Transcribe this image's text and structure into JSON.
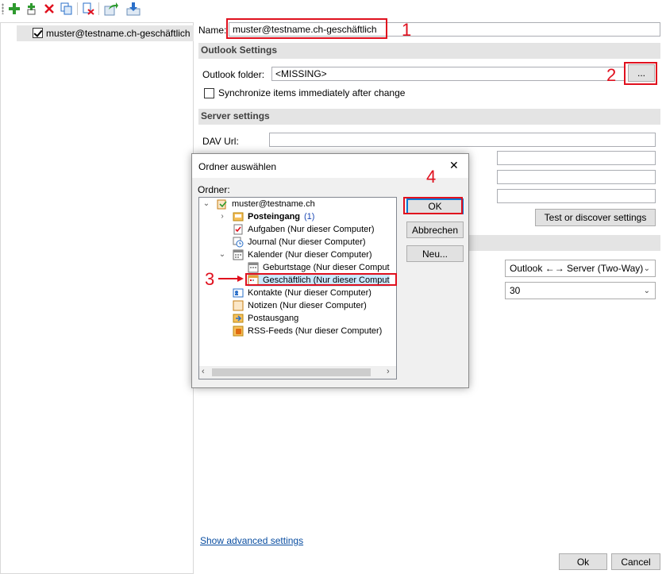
{
  "toolbar": {
    "items": [
      {
        "name": "add-profile-icon",
        "color": "#2e9a2e"
      },
      {
        "name": "add-multiple-profiles-icon",
        "color": "#2e9a2e"
      },
      {
        "name": "delete-icon",
        "color": "#e0101e"
      },
      {
        "name": "copy-icon",
        "color": "#2a6fc9"
      },
      {
        "name": "clear-cache-icon",
        "color": "#e0101e"
      },
      {
        "name": "export-icon",
        "color": "#2e9a2e"
      },
      {
        "name": "import-icon",
        "color": "#2a6fc9"
      }
    ]
  },
  "tree": {
    "profile_label": "muster@testname.ch-geschäftlich",
    "profile_checked": true
  },
  "form": {
    "name_label": "Name:",
    "name_value": "muster@testname.ch-geschäftlich",
    "outlook_section": "Outlook Settings",
    "outlook_folder_label": "Outlook folder:",
    "outlook_folder_value": "<MISSING>",
    "browse_label": "...",
    "sync_label": "Synchronize items immediately after change",
    "server_section": "Server settings",
    "dav_url_label": "DAV Url:",
    "test_button": "Test or discover settings",
    "sync_mode_value": "Outlook ←→ Server (Two-Way)",
    "sync_interval_value": "30",
    "advanced_link": "Show advanced settings",
    "ok_button": "Ok",
    "cancel_button": "Cancel"
  },
  "annotations": {
    "n1": "1",
    "n2": "2",
    "n3": "3",
    "n4": "4",
    "color": "#e0101e"
  },
  "dialog": {
    "title": "Ordner auswählen",
    "close": "✕",
    "folder_label": "Ordner:",
    "ok": "OK",
    "cancel": "Abbrechen",
    "new": "Neu...",
    "nodes": [
      {
        "label": "muster@testname.ch",
        "icon": "mailbox-icon"
      },
      {
        "label": "Posteingang",
        "count": "(1)",
        "icon": "inbox-icon"
      },
      {
        "label": "Aufgaben (Nur dieser Computer)",
        "icon": "tasks-icon"
      },
      {
        "label": "Journal (Nur dieser Computer)",
        "icon": "journal-icon"
      },
      {
        "label": "Kalender (Nur dieser Computer)",
        "icon": "calendar-icon"
      },
      {
        "label": "Geburtstage (Nur dieser Comput",
        "icon": "calendar-icon"
      },
      {
        "label": "Geschäftlich (Nur dieser Comput",
        "icon": "calendar-icon"
      },
      {
        "label": "Kontakte (Nur dieser Computer)",
        "icon": "contacts-icon"
      },
      {
        "label": "Notizen (Nur dieser Computer)",
        "icon": "notes-icon"
      },
      {
        "label": "Postausgang",
        "icon": "outbox-icon"
      },
      {
        "label": "RSS-Feeds (Nur dieser Computer)",
        "icon": "rss-icon"
      }
    ]
  }
}
